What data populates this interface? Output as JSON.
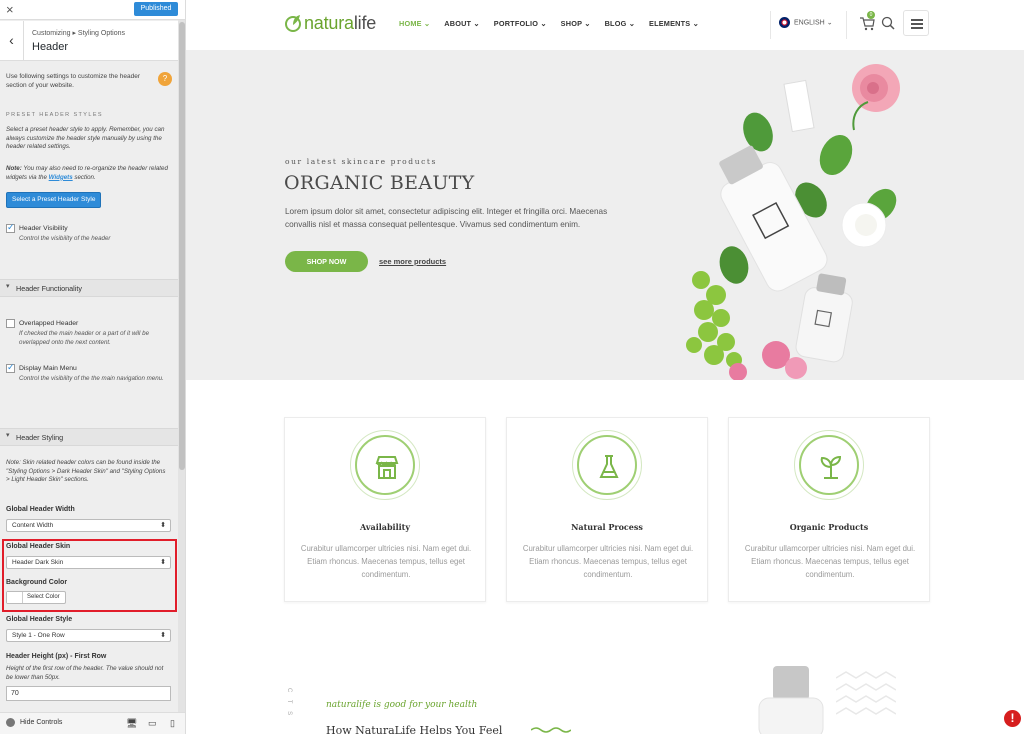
{
  "customizer": {
    "close_glyph": "×",
    "published_label": "Published",
    "back_glyph": "‹",
    "breadcrumb": "Customizing ▸ Styling Options",
    "panel_title": "Header",
    "intro": "Use following settings to customize the header section of your website.",
    "help_glyph": "?",
    "preset_section_label": "PRESET HEADER STYLES",
    "preset_text": "Select a preset header style to apply. Remember, you can always customize the header style manually by using the header related settings.",
    "note_label": "Note:",
    "note_text_a": " You may also need to re-organize the header related widgets via the ",
    "note_link": "Widgets",
    "note_text_b": " section.",
    "select_preset_button": "Select a Preset Header Style",
    "header_visibility": {
      "label": "Header Visibility",
      "desc": "Control the visibility of the header",
      "checked": true
    },
    "functionality_group": "Header Functionality",
    "overlapped_header": {
      "label": "Overlapped Header",
      "desc": "If checked the main header or a part of it will be overlapped onto the next content.",
      "checked": false
    },
    "display_main_menu": {
      "label": "Display Main Menu",
      "desc": "Control the visibility of the the main navigation menu.",
      "checked": true
    },
    "styling_group": "Header Styling",
    "skin_note": "Note: Skin related header colors can be found inside the \"Styling Options > Dark Header Skin\" and \"Styling Options > Light Header Skin\" sections.",
    "global_header_width": {
      "label": "Global Header Width",
      "value": "Content Width"
    },
    "global_header_skin": {
      "label": "Global Header Skin",
      "value": "Header Dark Skin"
    },
    "background_color": {
      "label": "Background Color",
      "button": "Select Color",
      "value": "#ffffff"
    },
    "global_header_style": {
      "label": "Global Header Style",
      "value": "Style 1 - One Row"
    },
    "header_height": {
      "label": "Header Height (px) - First Row",
      "desc": "Height of the first row of the header. The value should not be lower than 50px.",
      "value": "70"
    },
    "hide_controls": "Hide Controls",
    "devices": [
      "desktop-icon",
      "tablet-icon",
      "mobile-icon"
    ]
  },
  "site": {
    "logo_natura": "natura",
    "logo_life": "life",
    "menu": [
      {
        "label": "HOME",
        "active": true
      },
      {
        "label": "ABOUT",
        "active": false
      },
      {
        "label": "PORTFOLIO",
        "active": false
      },
      {
        "label": "SHOP",
        "active": false
      },
      {
        "label": "BLOG",
        "active": false
      },
      {
        "label": "ELEMENTS",
        "active": false
      }
    ],
    "language": "ENGLISH",
    "cart_count": "0",
    "hero": {
      "kicker": "our latest skincare products",
      "title": "ORGANIC BEAUTY",
      "text": "Lorem ipsum dolor sit amet, consectetur adipiscing elit. Integer et fringilla orci. Maecenas convallis nisl et massa consequat pellentesque. Vivamus sed condimentum enim.",
      "button": "SHOP NOW",
      "link": "see more products"
    },
    "features": [
      {
        "title": "Availability",
        "text": "Curabitur ullamcorper ultricies nisi. Nam eget dui. Etiam rhoncus. Maecenas tempus, tellus eget condimentum.",
        "icon": "shop-icon"
      },
      {
        "title": "Natural Process",
        "text": "Curabitur ullamcorper ultricies nisi. Nam eget dui. Etiam rhoncus. Maecenas tempus, tellus eget condimentum.",
        "icon": "flask-icon"
      },
      {
        "title": "Organic Products",
        "text": "Curabitur ullamcorper ultricies nisi. Nam eget dui. Etiam rhoncus. Maecenas tempus, tellus eget condimentum.",
        "icon": "sprout-icon"
      }
    ],
    "bottom_vertical": "C T S",
    "bottom_kicker": "naturalife is good for your health",
    "bottom_title": "How NaturaLife Helps You Feel",
    "error_glyph": "!"
  },
  "colors": {
    "accent": "#7ab648",
    "primary_button": "#2e8bd8",
    "highlight": "#e11d2a"
  }
}
